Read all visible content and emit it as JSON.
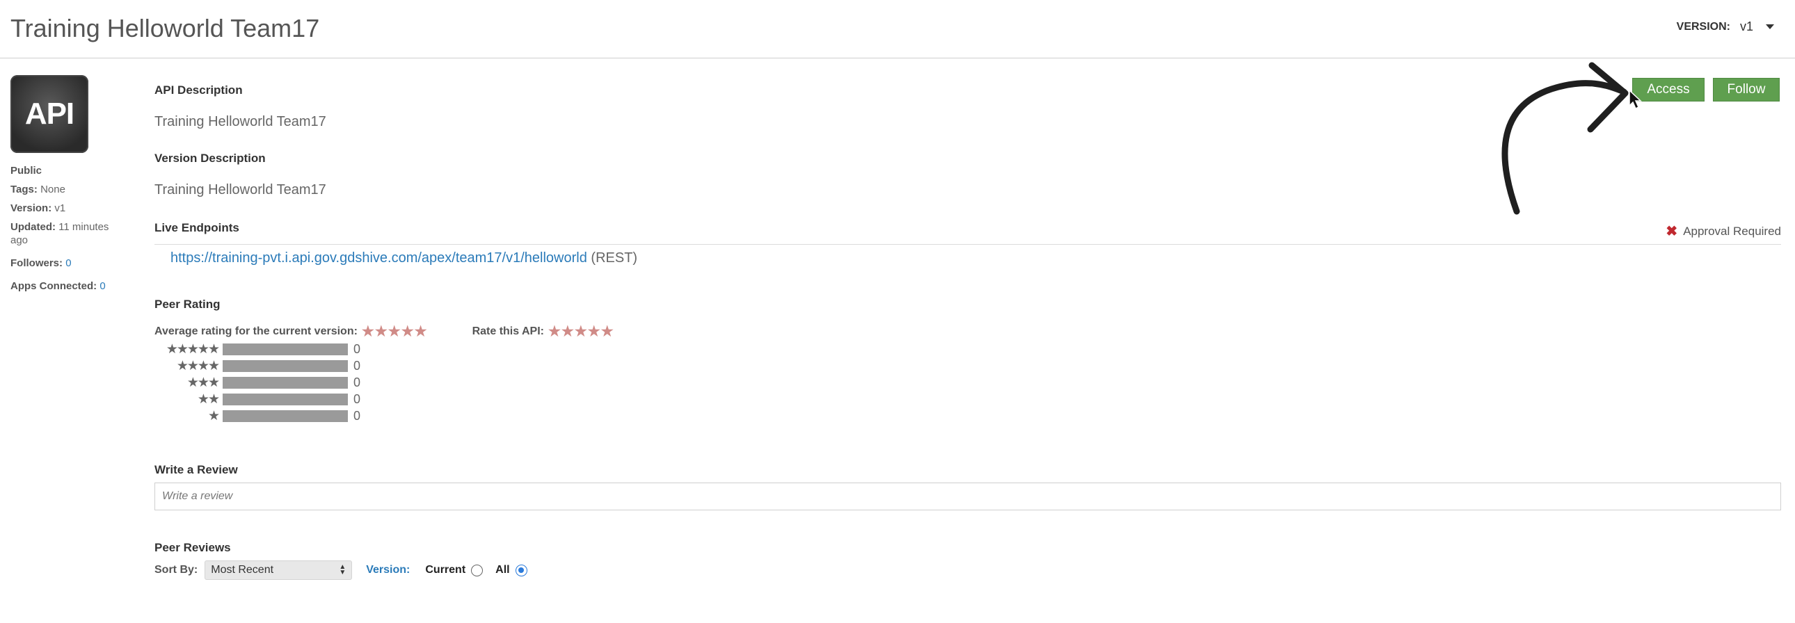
{
  "header": {
    "title": "Training Helloworld Team17",
    "version_label": "VERSION:",
    "version_value": "v1"
  },
  "sidebar": {
    "logo_text": "API",
    "visibility": "Public",
    "tags_label": "Tags:",
    "tags_value": "None",
    "version_label": "Version:",
    "version_value": "v1",
    "updated_label": "Updated:",
    "updated_value": "11 minutes ago",
    "followers_label": "Followers:",
    "followers_value": "0",
    "apps_label": "Apps Connected:",
    "apps_value": "0"
  },
  "main": {
    "api_description_label": "API Description",
    "api_description": "Training Helloworld Team17",
    "version_description_label": "Version Description",
    "version_description": "Training Helloworld Team17",
    "live_endpoints_label": "Live Endpoints",
    "approval_required": "Approval Required",
    "endpoint_url": "https://training-pvt.i.api.gov.gdshive.com/apex/team17/v1/helloworld",
    "endpoint_type": "(REST)",
    "peer_rating_label": "Peer Rating",
    "avg_rating_label": "Average rating for the current version:",
    "rate_label": "Rate this API:",
    "rating_distribution": [
      {
        "stars": 5,
        "count": "0",
        "fraction": 1.0
      },
      {
        "stars": 4,
        "count": "0",
        "fraction": 1.0
      },
      {
        "stars": 3,
        "count": "0",
        "fraction": 1.0
      },
      {
        "stars": 2,
        "count": "0",
        "fraction": 1.0
      },
      {
        "stars": 1,
        "count": "0",
        "fraction": 1.0
      }
    ],
    "write_review_label": "Write a Review",
    "review_placeholder": "Write a review",
    "peer_reviews_label": "Peer Reviews",
    "sort_by_label": "Sort By:",
    "sort_value": "Most Recent",
    "version_filter_label": "Version:",
    "current_label": "Current",
    "all_label": "All"
  },
  "actions": {
    "access_label": "Access",
    "follow_label": "Follow"
  },
  "colors": {
    "button_green": "#5f9f4f",
    "link_blue": "#2b7bb9",
    "star_red": "#d08b87",
    "approval_x": "#c0282f"
  }
}
